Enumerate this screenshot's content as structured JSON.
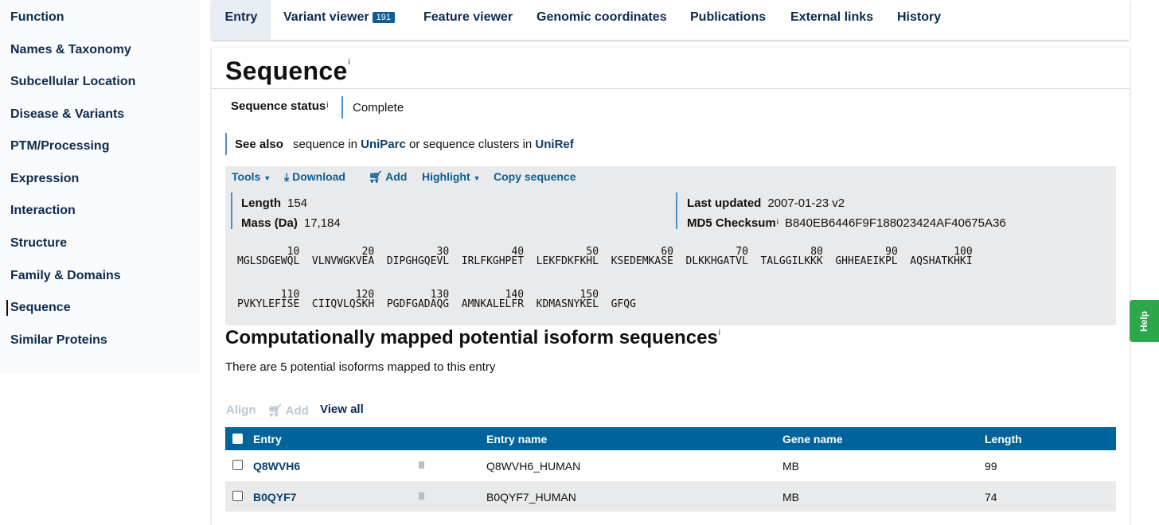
{
  "sidebar": {
    "items": [
      "Function",
      "Names & Taxonomy",
      "Subcellular Location",
      "Disease & Variants",
      "PTM/Processing",
      "Expression",
      "Interaction",
      "Structure",
      "Family & Domains",
      "Sequence",
      "Similar Proteins"
    ],
    "active": "Sequence"
  },
  "tabs": {
    "entry": "Entry",
    "variant_viewer": "Variant viewer",
    "variant_count": "191",
    "feature_viewer": "Feature viewer",
    "genomic": "Genomic coordinates",
    "publications": "Publications",
    "external": "External links",
    "history": "History"
  },
  "section": {
    "title": "Sequence",
    "info_mark": "i",
    "status_label": "Sequence status",
    "status_value": "Complete",
    "see_also_label": "See also",
    "see_also_text1": "sequence in",
    "see_also_link1": "UniParc",
    "see_also_text2": "or sequence clusters in",
    "see_also_link2": "UniRef"
  },
  "toolbar": {
    "tools": "Tools",
    "download": "Download",
    "add": "Add",
    "highlight": "Highlight",
    "copy": "Copy sequence"
  },
  "meta": {
    "length_label": "Length",
    "length_value": "154",
    "mass_label": "Mass (Da)",
    "mass_value": "17,184",
    "updated_label": "Last updated",
    "updated_value": "2007-01-23 v2",
    "md5_label": "MD5 Checksum",
    "md5_value": "B840EB6446F9F188023424AF40675A36"
  },
  "sequence": {
    "line1": "MGLSDGEWQL  VLNVWGKVEA  DIPGHGQEVL  IRLFKGHPET  LEKFDKFKHL  KSEDEMKASE  DLKKHGATVL  TALGGILKKK  GHHEAEIKPL  AQSHATKHKI",
    "line2": "PVKYLEFISE  CIIQVLQSKH  PGDFGADAQG  AMNKALELFR  KDMASNYKEL  GFQG",
    "nums1": [
      "10",
      "20",
      "30",
      "40",
      "50",
      "60",
      "70",
      "80",
      "90",
      "100"
    ],
    "nums2": [
      "110",
      "120",
      "130",
      "140",
      "150"
    ]
  },
  "isoforms": {
    "title": "Computationally mapped potential isoform sequences",
    "description": "There are 5 potential isoforms mapped to this entry",
    "align": "Align",
    "add": "Add",
    "view_all": "View all",
    "headers": [
      "Entry",
      "Entry name",
      "Gene name",
      "Length"
    ],
    "rows": [
      {
        "entry": "Q8WVH6",
        "name": "Q8WVH6_HUMAN",
        "gene": "MB",
        "length": "99"
      },
      {
        "entry": "B0QYF7",
        "name": "B0QYF7_HUMAN",
        "gene": "MB",
        "length": "74"
      }
    ]
  },
  "help": "Help",
  "colors": {
    "accent": "#00639c",
    "link": "#0b5f93",
    "help": "#2aa84a",
    "status_bar": "#4a90c4"
  }
}
